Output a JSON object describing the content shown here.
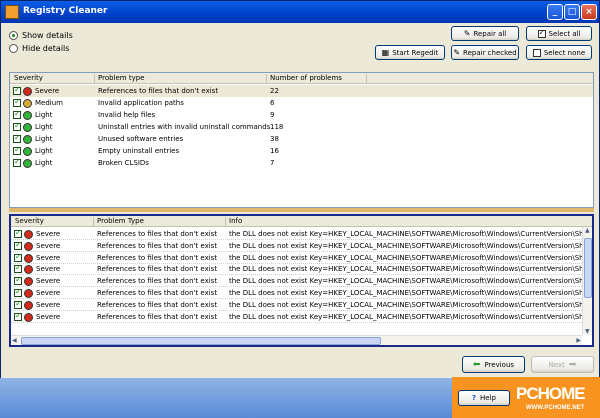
{
  "window": {
    "title": "Registry Cleaner"
  },
  "view": {
    "show_details": "Show details",
    "hide_details": "Hide details"
  },
  "toolbar": {
    "repair_all": "Repair all",
    "select_all": "Select all",
    "start_regedit": "Start Regedit",
    "repair_checked": "Repair checked",
    "select_none": "Select none"
  },
  "summary": {
    "headers": [
      "Severity",
      "Problem type",
      "Number of problems"
    ],
    "rows": [
      {
        "severity": "Severe",
        "level": "severe",
        "problem": "References to files that don't exist",
        "count": "22"
      },
      {
        "severity": "Medium",
        "level": "medium",
        "problem": "Invalid application paths",
        "count": "6"
      },
      {
        "severity": "Light",
        "level": "light",
        "problem": "Invalid help files",
        "count": "9"
      },
      {
        "severity": "Light",
        "level": "light",
        "problem": "Uninstall entries with invalid uninstall commands",
        "count": "118"
      },
      {
        "severity": "Light",
        "level": "light",
        "problem": "Unused software entries",
        "count": "38"
      },
      {
        "severity": "Light",
        "level": "light",
        "problem": "Empty uninstall entries",
        "count": "16"
      },
      {
        "severity": "Light",
        "level": "light",
        "problem": "Broken CLSIDs",
        "count": "7"
      }
    ]
  },
  "details": {
    "headers": [
      "Severity",
      "Problem Type",
      "Info"
    ],
    "rows": [
      {
        "severity": "Severe",
        "problem": "References to files that don't exist",
        "info": "the DLL does not exist  Key=HKEY_LOCAL_MACHINE\\SOFTWARE\\Microsoft\\Windows\\CurrentVersion\\SharedD"
      },
      {
        "severity": "Severe",
        "problem": "References to files that don't exist",
        "info": "the DLL does not exist  Key=HKEY_LOCAL_MACHINE\\SOFTWARE\\Microsoft\\Windows\\CurrentVersion\\SharedD"
      },
      {
        "severity": "Severe",
        "problem": "References to files that don't exist",
        "info": "the DLL does not exist  Key=HKEY_LOCAL_MACHINE\\SOFTWARE\\Microsoft\\Windows\\CurrentVersion\\SharedD"
      },
      {
        "severity": "Severe",
        "problem": "References to files that don't exist",
        "info": "the DLL does not exist  Key=HKEY_LOCAL_MACHINE\\SOFTWARE\\Microsoft\\Windows\\CurrentVersion\\SharedD"
      },
      {
        "severity": "Severe",
        "problem": "References to files that don't exist",
        "info": "the DLL does not exist  Key=HKEY_LOCAL_MACHINE\\SOFTWARE\\Microsoft\\Windows\\CurrentVersion\\SharedD"
      },
      {
        "severity": "Severe",
        "problem": "References to files that don't exist",
        "info": "the DLL does not exist  Key=HKEY_LOCAL_MACHINE\\SOFTWARE\\Microsoft\\Windows\\CurrentVersion\\SharedD"
      },
      {
        "severity": "Severe",
        "problem": "References to files that don't exist",
        "info": "the DLL does not exist  Key=HKEY_LOCAL_MACHINE\\SOFTWARE\\Microsoft\\Windows\\CurrentVersion\\SharedD"
      },
      {
        "severity": "Severe",
        "problem": "References to files that don't exist",
        "info": "the DLL does not exist  Key=HKEY_LOCAL_MACHINE\\SOFTWARE\\Microsoft\\Windows\\CurrentVersion\\SharedD"
      }
    ]
  },
  "nav": {
    "previous": "Previous",
    "next": "Next",
    "help": "Help"
  },
  "watermark": {
    "line1": "PCHOME",
    "line2": "WWW.PCHOME.NET"
  },
  "colors": {
    "severe": "#d42a1c",
    "medium": "#d8a83a",
    "light": "#32b43a"
  }
}
